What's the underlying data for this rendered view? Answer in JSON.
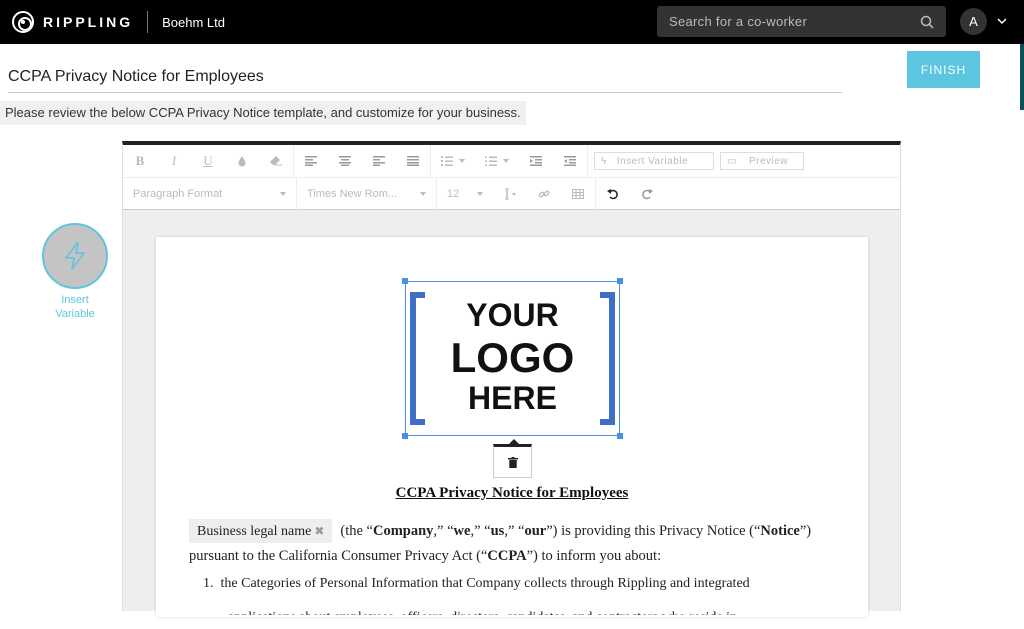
{
  "topbar": {
    "brand": "RIPPLING",
    "company": "Boehm Ltd",
    "search_placeholder": "Search for a co-worker",
    "avatar_initial": "A"
  },
  "header": {
    "doc_title": "CCPA Privacy Notice for Employees",
    "finish_label": "FINISH",
    "instructions": "Please review the below CCPA Privacy Notice template, and customize for your business."
  },
  "side": {
    "insert_variable_label": "Insert Variable",
    "accent": "#5cc6e0"
  },
  "toolbar": {
    "row1": {
      "bold": "B",
      "italic": "I",
      "underline": "U",
      "insert_variable": "Insert Variable",
      "preview": "Preview"
    },
    "row2": {
      "paragraph_format": "Paragraph Format",
      "font_family": "Times New Rom...",
      "font_size": "12"
    }
  },
  "document": {
    "logo_lines": [
      "YOUR",
      "LOGO",
      "HERE"
    ],
    "heading": "CCPA Privacy Notice for Employees",
    "chip_label": "Business legal name",
    "para_parts": {
      "p1": "(the “",
      "company": "Company",
      "p2": ",” “",
      "we": "we",
      "p3": ",” “",
      "us": "us",
      "p4": ",” “",
      "our": "our",
      "p5": "”) is providing this Privacy Notice (“",
      "notice": "Notice",
      "p6": "”) pursuant to the California Consumer Privacy Act (“",
      "ccpa": "CCPA",
      "p7": "”) to inform you about:"
    },
    "list_item_1": "the Categories of Personal Information that Company collects through Rippling and integrated",
    "list_item_1_number": "1.",
    "list_item_1_continued": "applications about employees, officers, directors, candidates, and contractors who reside in"
  }
}
